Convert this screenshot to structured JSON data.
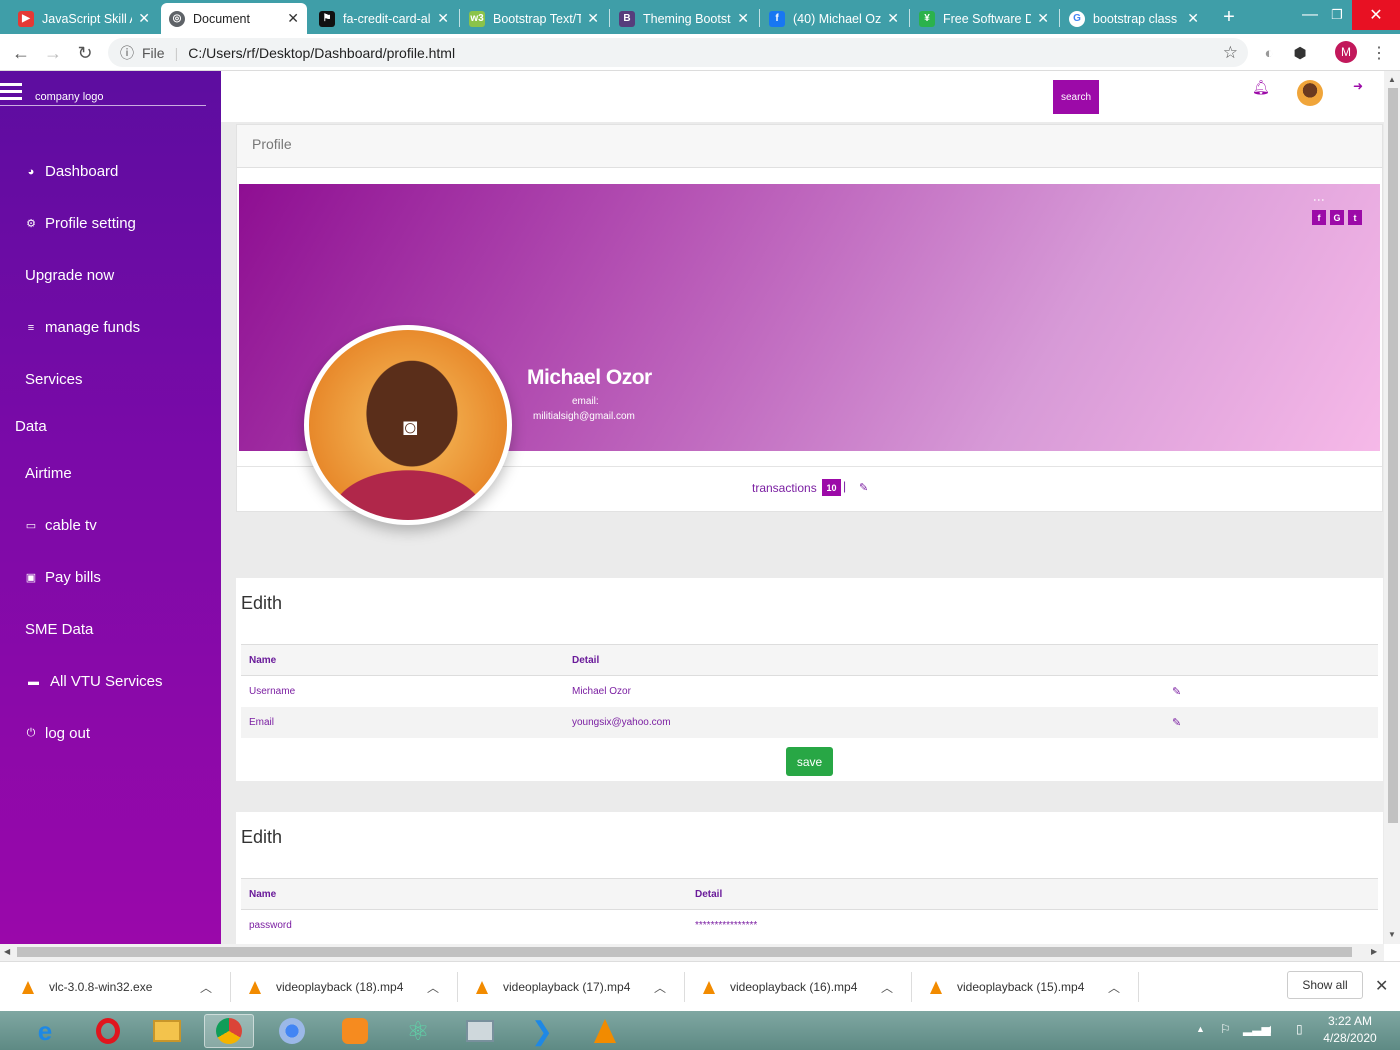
{
  "browser": {
    "tabs": [
      {
        "title": "JavaScript Skill A",
        "color": "#e53935"
      },
      {
        "title": "Document",
        "color": "#5f6368",
        "active": true
      },
      {
        "title": "fa-credit-card-al",
        "color": "#111111"
      },
      {
        "title": "Bootstrap Text/T",
        "color": "#8bc34a"
      },
      {
        "title": "Theming Bootst",
        "color": "#563d7c"
      },
      {
        "title": "(40) Michael Oz",
        "color": "#1877f2"
      },
      {
        "title": "Free Software D",
        "color": "#2bb24c"
      },
      {
        "title": "bootstrap class",
        "color": "#4285f4"
      }
    ],
    "new_tab": "+",
    "address": {
      "scheme_label": "File",
      "url": "C:/Users/rf/Desktop/Dashboard/profile.html"
    },
    "profile_initial": "M"
  },
  "sidebar": {
    "logo_text": "company logo",
    "items": [
      {
        "label": "Dashboard",
        "icon": "dashboard-icon",
        "glyph": "◕"
      },
      {
        "label": "Profile setting",
        "icon": "gear-icon",
        "glyph": "⚙"
      },
      {
        "label": "Upgrade now",
        "icon": "",
        "glyph": ""
      },
      {
        "label": "manage funds",
        "icon": "list-icon",
        "glyph": "≡"
      },
      {
        "label": "Services",
        "icon": "",
        "glyph": ""
      },
      {
        "label": "Data",
        "icon": "",
        "glyph": ""
      },
      {
        "label": "Airtime",
        "icon": "",
        "glyph": ""
      },
      {
        "label": "cable tv",
        "icon": "tv-icon",
        "glyph": "▭"
      },
      {
        "label": "Pay bills",
        "icon": "money-icon",
        "glyph": "▣"
      },
      {
        "label": "SME Data",
        "icon": "",
        "glyph": ""
      },
      {
        "label": "All VTU Services",
        "icon": "card-icon",
        "glyph": "▬"
      },
      {
        "label": "log out",
        "icon": "power-icon",
        "glyph": "⏻"
      }
    ]
  },
  "topbar": {
    "search_button": "search",
    "search_value": ""
  },
  "profile": {
    "header": "Profile",
    "name": "Michael Ozor",
    "email_label": "email:",
    "email": "militialsigh@gmail.com",
    "social": [
      "f",
      "G",
      "t"
    ],
    "transactions_label": "transactions",
    "transactions_count": "10",
    "separator": "|"
  },
  "edit_card_1": {
    "title": "Edith",
    "columns": [
      "Name",
      "Detail"
    ],
    "rows": [
      {
        "name": "Username",
        "detail": "Michael Ozor"
      },
      {
        "name": "Email",
        "detail": "youngsix@yahoo.com"
      }
    ],
    "save_label": "save"
  },
  "edit_card_2": {
    "title": "Edith",
    "columns": [
      "Name",
      "Detail"
    ],
    "rows": [
      {
        "name": "password",
        "detail": "****************"
      }
    ]
  },
  "downloads": {
    "items": [
      "vlc-3.0.8-win32.exe",
      "videoplayback (18).mp4",
      "videoplayback (17).mp4",
      "videoplayback (16).mp4",
      "videoplayback (15).mp4"
    ],
    "show_all": "Show all"
  },
  "taskbar": {
    "time": "3:22 AM",
    "date": "4/28/2020"
  },
  "colors": {
    "accent": "#9c0aa8",
    "sidebar_top": "#5d0da0",
    "save": "#28a745",
    "tabstrip": "#3f9ea8"
  }
}
